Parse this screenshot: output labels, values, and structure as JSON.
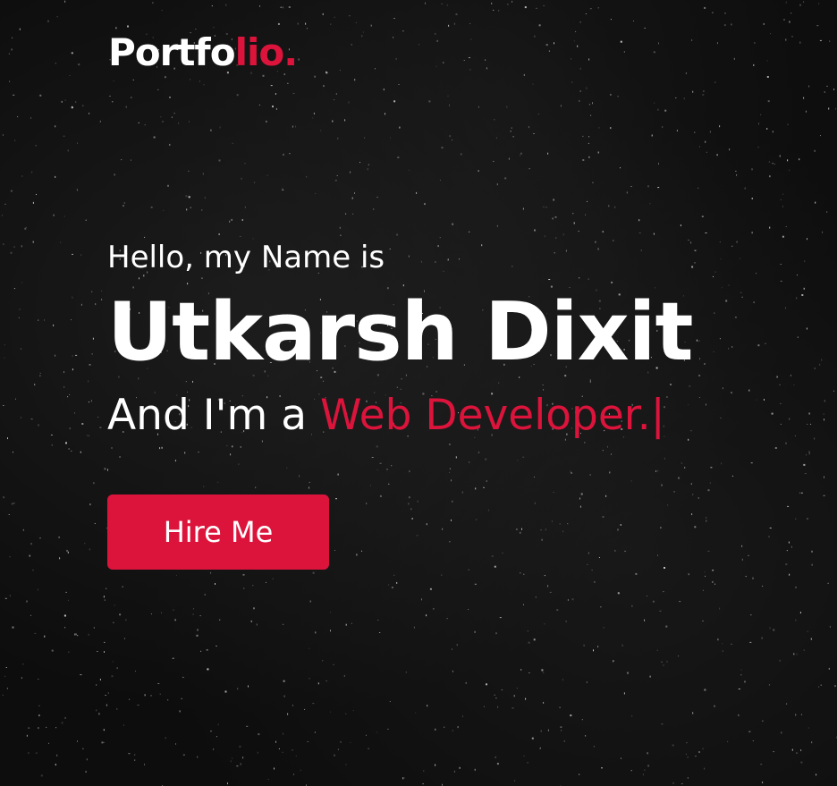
{
  "header": {
    "logo_main": "Portfo",
    "logo_accent": "lio."
  },
  "hero": {
    "greeting": "Hello, my Name is",
    "name": "Utkarsh Dixit",
    "role_prefix": "And I'm a ",
    "role_highlight": "Web Developer.",
    "cursor": "|",
    "hire_button": "Hire Me"
  },
  "colors": {
    "accent": "#dc143c",
    "background": "#0d0d0d",
    "text": "#ffffff"
  }
}
